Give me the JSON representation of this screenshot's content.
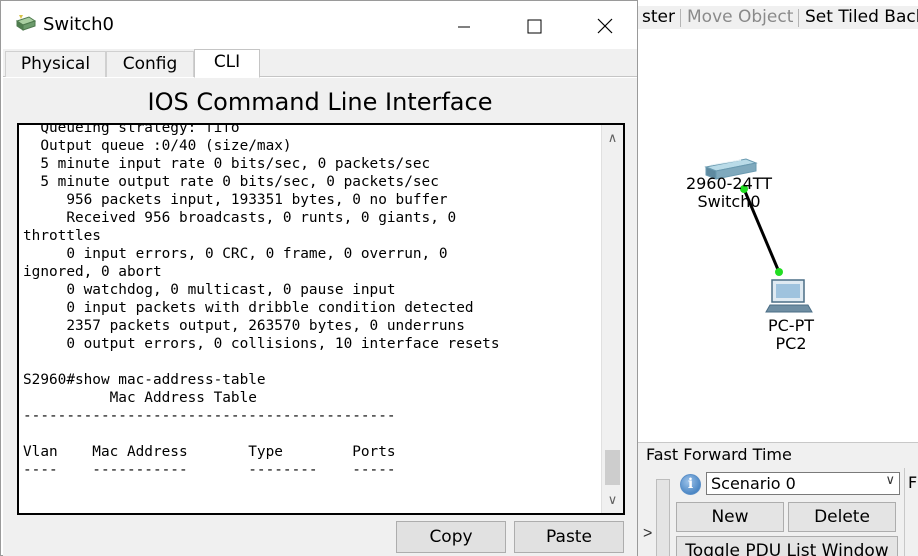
{
  "background": {
    "toolbar": {
      "items": [
        "ster",
        "Move Object",
        "Set Tiled Back"
      ]
    },
    "devices": [
      {
        "model": "2960-24TT",
        "name": "Switch0",
        "icon": "switch-icon"
      },
      {
        "model": "PC-PT",
        "name": "PC2",
        "icon": "pc-icon"
      }
    ],
    "link_color": "#000000",
    "link_status_color": "#22dd22",
    "bottom": {
      "fast_forward_label": "Fast Forward Time",
      "scenario_selected": "Scenario 0",
      "new_label": "New",
      "delete_label": "Delete",
      "toggle_label": "Toggle PDU List Window",
      "fragment": "F"
    }
  },
  "window": {
    "title": "Switch0",
    "icon": "switch-app-icon",
    "controls": [
      "minimize-icon",
      "maximize-icon",
      "close-icon"
    ],
    "tabs": [
      {
        "label": "Physical",
        "active": false
      },
      {
        "label": "Config",
        "active": false
      },
      {
        "label": "CLI",
        "active": true
      }
    ],
    "heading": "IOS Command Line Interface",
    "terminal_lines": [
      "  Queueing strategy: fifo",
      "  Output queue :0/40 (size/max)",
      "  5 minute input rate 0 bits/sec, 0 packets/sec",
      "  5 minute output rate 0 bits/sec, 0 packets/sec",
      "     956 packets input, 193351 bytes, 0 no buffer",
      "     Received 956 broadcasts, 0 runts, 0 giants, 0",
      "throttles",
      "     0 input errors, 0 CRC, 0 frame, 0 overrun, 0",
      "ignored, 0 abort",
      "     0 watchdog, 0 multicast, 0 pause input",
      "     0 input packets with dribble condition detected",
      "     2357 packets output, 263570 bytes, 0 underruns",
      "     0 output errors, 0 collisions, 10 interface resets",
      "",
      "S2960#show mac-address-table",
      "          Mac Address Table",
      "-------------------------------------------",
      "",
      "Vlan    Mac Address       Type        Ports",
      "----    -----------       --------    -----",
      "",
      ""
    ],
    "prompt": "S2960#",
    "copy_label": "Copy",
    "paste_label": "Paste"
  }
}
